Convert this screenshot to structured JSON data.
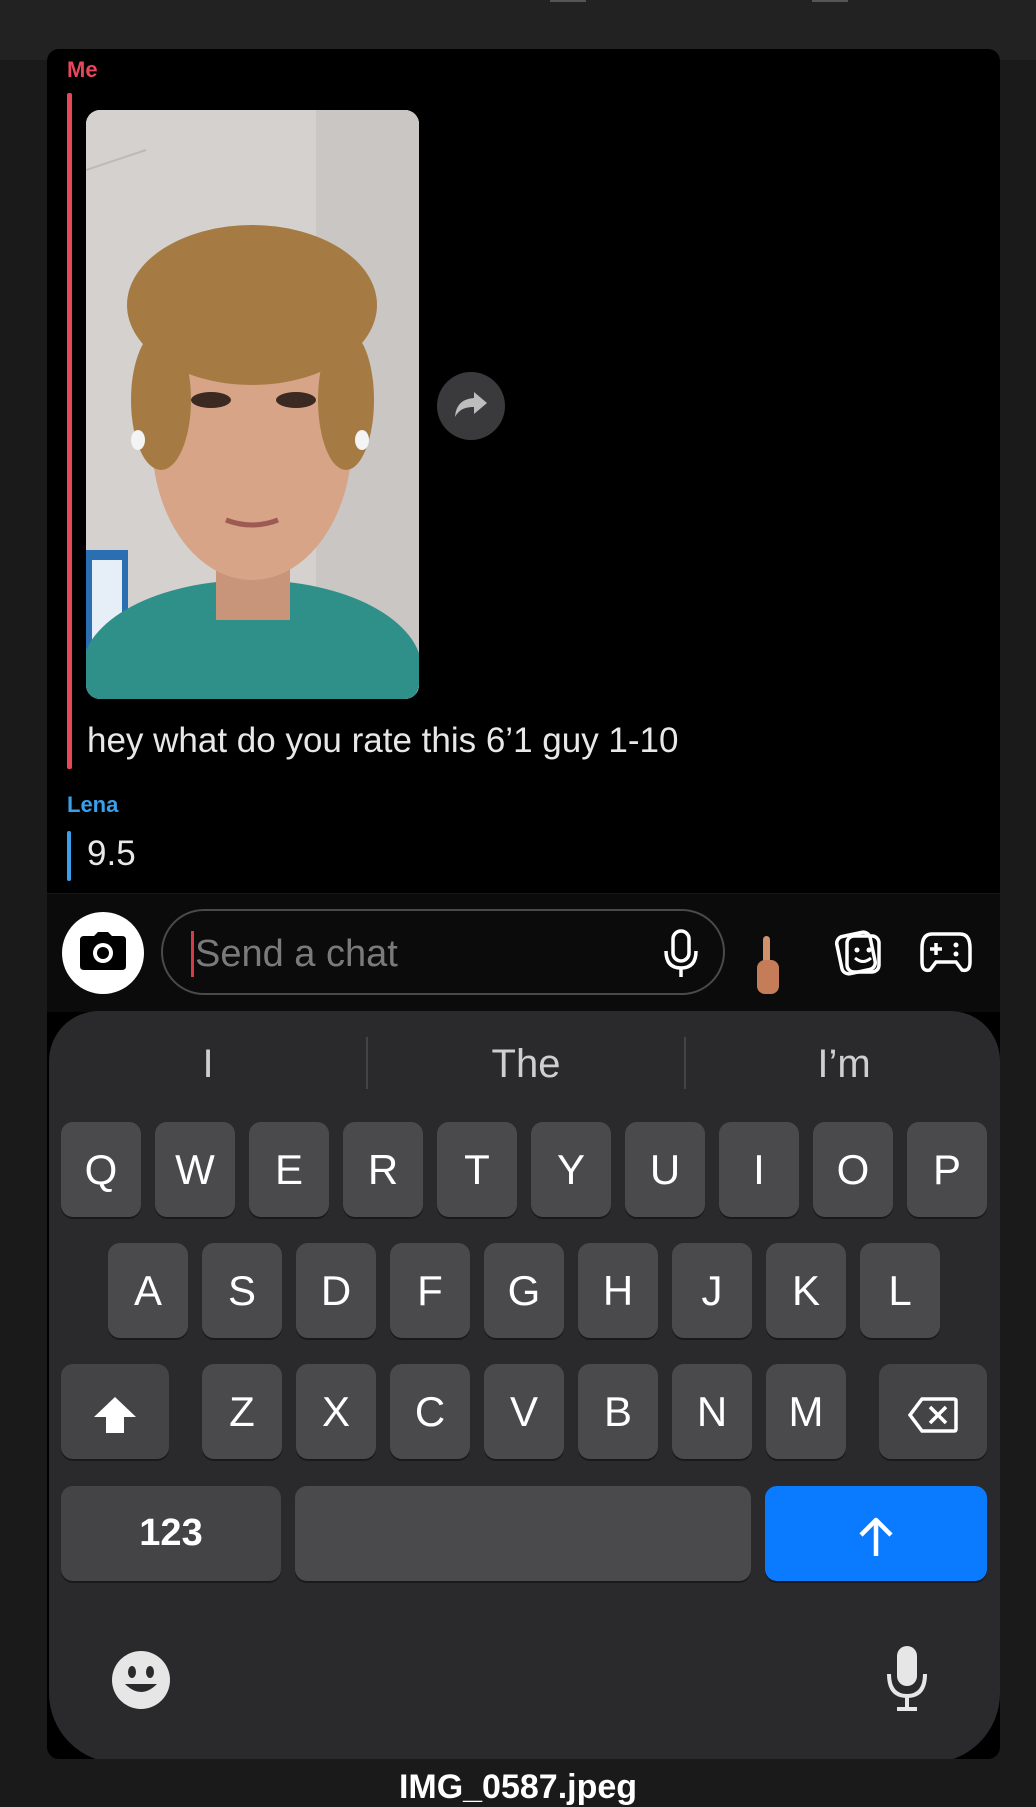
{
  "chat": {
    "me_label": "Me",
    "message_1": "hey what do you rate this 6’1 guy 1-10",
    "lena_label": "Lena",
    "message_2": "9.5"
  },
  "input": {
    "placeholder": "Send a chat"
  },
  "keyboard": {
    "suggestions": [
      "I",
      "The",
      "I’m"
    ],
    "row1": [
      "Q",
      "W",
      "E",
      "R",
      "T",
      "Y",
      "U",
      "I",
      "O",
      "P"
    ],
    "row2": [
      "A",
      "S",
      "D",
      "F",
      "G",
      "H",
      "J",
      "K",
      "L"
    ],
    "row3": [
      "Z",
      "X",
      "C",
      "V",
      "B",
      "N",
      "M"
    ],
    "numbers_label": "123"
  },
  "footer": {
    "filename": "IMG_0587.jpeg"
  },
  "colors": {
    "me": "#e8475b",
    "lena": "#3aa0ea",
    "send_key": "#0a7aff"
  },
  "icons": [
    "share-icon",
    "camera-icon",
    "microphone-icon",
    "pointing-finger-icon",
    "sticker-icon",
    "game-controller-icon",
    "shift-icon",
    "delete-icon",
    "send-arrow-icon",
    "emoji-icon",
    "dictation-mic-icon"
  ]
}
